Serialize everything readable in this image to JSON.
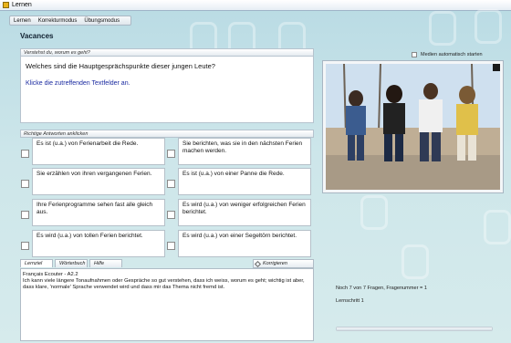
{
  "window": {
    "title": "Lernen"
  },
  "menu": {
    "items": [
      "Lernen",
      "Korrekturmodus",
      "Übungsmodus"
    ]
  },
  "page": {
    "title": "Vacances"
  },
  "question_panel": {
    "header": "Verstehst du, worum es geht?",
    "question": "Welches sind die Hauptgesprächspunkte dieser jungen Leute?",
    "instruction": "Klicke die zutreffenden Textfelder an."
  },
  "media": {
    "autostart_label": "Medien automatisch starten",
    "autostart_checked": false
  },
  "answers_panel": {
    "header": "Richtige Antworten anklicken",
    "items": [
      {
        "text": "Es ist (u.a.) von Ferienarbeit die Rede.",
        "checked": false
      },
      {
        "text": "Sie berichten, was sie in den nächsten Ferien machen werden.",
        "checked": false
      },
      {
        "text": "Sie erzählen von ihren vergangenen Ferien.",
        "checked": false
      },
      {
        "text": "Es ist (u.a.) von einer Panne die Rede.",
        "checked": false
      },
      {
        "text": "Ihre Ferienprogramme sehen fast alle gleich aus.",
        "checked": false
      },
      {
        "text": "Es wird (u.a.) von weniger erfolgreichen Ferien berichtet.",
        "checked": false
      },
      {
        "text": "Es wird (u.a.) von tollen Ferien berichtet.",
        "checked": false
      },
      {
        "text": "Es wird (u.a.) von einer Segeltörn berichtet.",
        "checked": false
      }
    ]
  },
  "bottom": {
    "tabs": [
      "Lernziel",
      "Wörterbuch",
      "Hilfe"
    ],
    "active_tab": "Lernziel",
    "korrigieren_label": "Korrigieren",
    "info_title": "Français Ecouter - A2.2",
    "info_text": "Ich kann viele längere Tonaufnahmen oder Gespräche so gut verstehen, dass ich weiss, worum es geht; wichtig ist aber, dass klare, 'normale' Sprache verwendet wird und dass mir das Thema nicht fremd ist."
  },
  "status": {
    "line1": "Noch 7 von 7 Fragen, Fragenummer = 1",
    "line2": "Lernschritt 1"
  },
  "colors": {
    "instruction": "#1a2aa0",
    "background": "#cde6ea"
  }
}
